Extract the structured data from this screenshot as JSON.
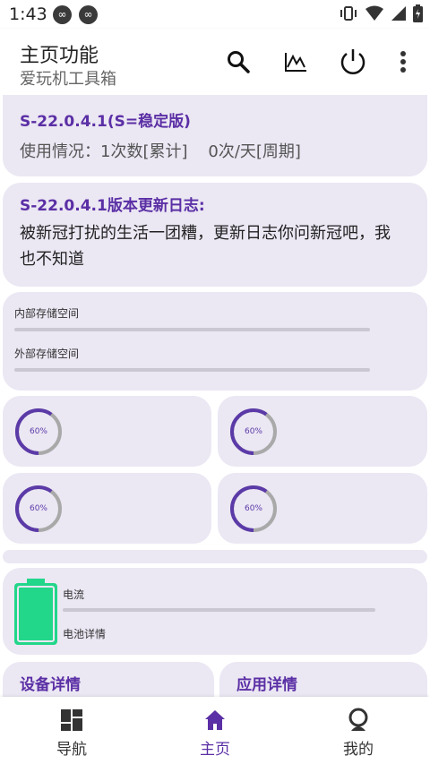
{
  "status_bar": {
    "time": "1:43"
  },
  "app_bar": {
    "title": "主页功能",
    "subtitle": "爱玩机工具箱"
  },
  "version_card": {
    "title": "S-22.0.4.1(S=稳定版)",
    "usage_text": "使用情况：1次数[累计]    0次/天[周期]"
  },
  "changelog_card": {
    "title": "S-22.0.4.1版本更新日志:",
    "body_line1": "被新冠打扰的生活一团糟，更新日志你问新冠吧，我",
    "body_line2": "也不知道"
  },
  "storage_card": {
    "internal_label": "内部存储空间",
    "external_label": "外部存储空间"
  },
  "rings": [
    {
      "label": "60%",
      "progress": 0.6
    },
    {
      "label": "60%",
      "progress": 0.6
    },
    {
      "label": "60%",
      "progress": 0.6
    },
    {
      "label": "60%",
      "progress": 0.6
    }
  ],
  "battery_card": {
    "current_label": "电流",
    "details_label": "电池详情"
  },
  "detail_cards": {
    "device": "设备详情",
    "app": "应用详情"
  },
  "bottom_nav": {
    "items": [
      {
        "label": "导航",
        "active": false
      },
      {
        "label": "主页",
        "active": true
      },
      {
        "label": "我的",
        "active": false
      }
    ]
  },
  "colors": {
    "accent": "#5b2fa5",
    "card_bg": "#ebe7f3",
    "ring_fill": "#5b3aa8",
    "ring_track": "#a9a9a9",
    "battery_green": "#22d68a"
  }
}
